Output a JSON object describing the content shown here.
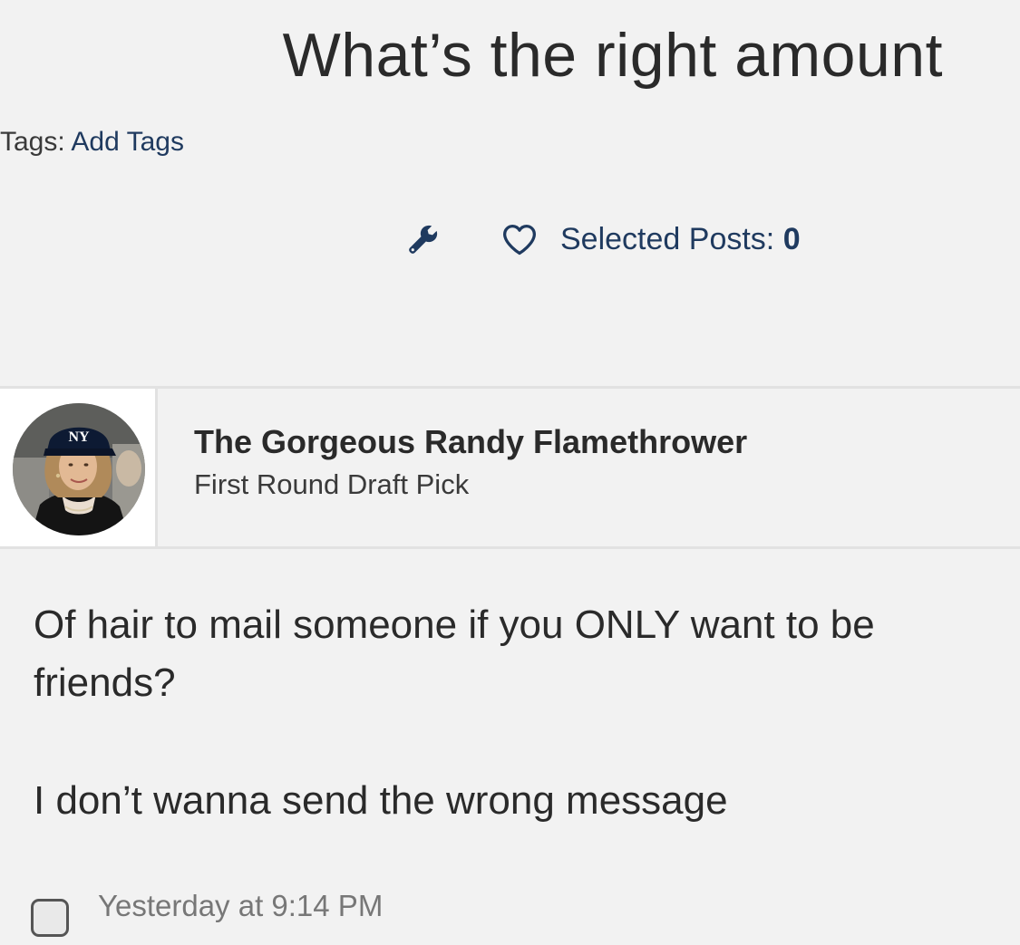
{
  "thread": {
    "title": "What’s the right amount"
  },
  "tags": {
    "label": "Tags:",
    "link": "Add Tags"
  },
  "toolbar": {
    "tools_icon": "wrench-icon",
    "watch_icon": "heart-icon",
    "selected_label": "Selected Posts:",
    "selected_count": "0",
    "icon_color": "#1f3a5f"
  },
  "post": {
    "author_name": "The Gorgeous Randy Flamethrower",
    "author_title": "First Round Draft Pick",
    "avatar": "avatar-photo",
    "body": [
      "Of hair to mail someone if you ONLY want to be friends?",
      "I don’t wanna send the wrong message"
    ],
    "timestamp": "Yesterday at 9:14 PM"
  }
}
